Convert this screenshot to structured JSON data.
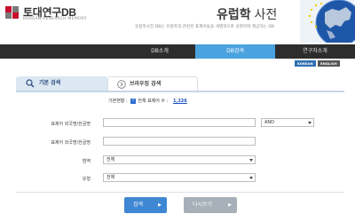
{
  "header": {
    "logo_title": "토대연구DB",
    "logo_subtitle": "KOREAN RESEARCH MEMORY",
    "site_title_bold": "유럽학",
    "site_title_rest": " 사전",
    "description": "유럽학사전 DB는 유럽학과 관련된 표제어들을 개별적으로 설명하여 제공하는 DB"
  },
  "nav": {
    "items": [
      "DB소개",
      "DB검색",
      "연구자소개"
    ],
    "active_index": 1
  },
  "lang": {
    "ko": "KOREAN",
    "en": "ENGLISH"
  },
  "tabs": {
    "basic": "기본 검색",
    "browse": "브라우징 검색",
    "active": "basic"
  },
  "stats": {
    "label": "기본현황 :",
    "check_text": "전체 표제어 수 :",
    "count": "1,226"
  },
  "form": {
    "row1_label": "표제어 외국명/한글명",
    "row1_value": "",
    "operator": "AND",
    "row2_label": "표제어 외국명/한글명",
    "row2_value": "",
    "row3_label": "범역",
    "row3_value": "전체",
    "row4_label": "유형",
    "row4_value": "전체"
  },
  "buttons": {
    "search": "검색",
    "search_arrow": "▶",
    "reset": "다시쓰기",
    "reset_arrow": "▶"
  },
  "colors": {
    "nav_bg": "#2d2d2d",
    "nav_active": "#4aa3df",
    "search_button": "#3f87d2",
    "reset_button": "#a7afb8",
    "link": "#1a4fc4"
  }
}
